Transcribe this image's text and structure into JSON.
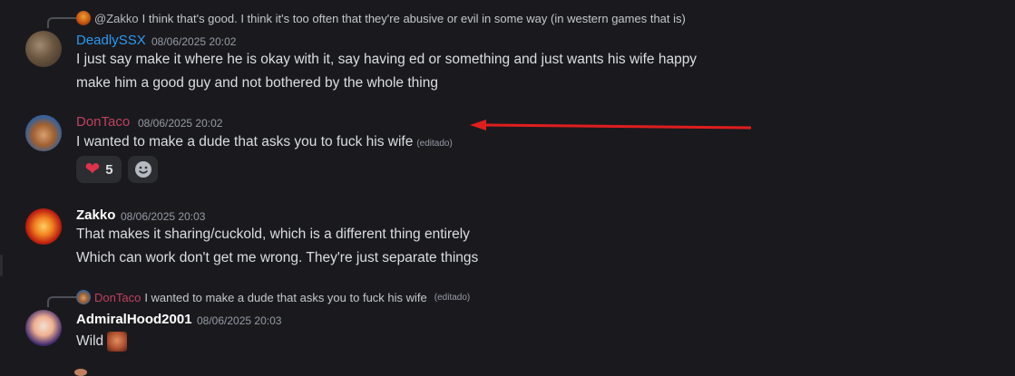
{
  "messages": [
    {
      "reply": {
        "name": "@Zakko",
        "text": "I think that's good. I think it's too often that they're abusive or evil in some way (in western games that is)"
      },
      "username": "DeadlySSX",
      "username_color": "#2b9af3",
      "timestamp": "08/06/2025 20:02",
      "lines": [
        "I just say make it where he is okay with it, say having ed or something and just wants his wife happy",
        "make him a good guy and not bothered by the whole thing"
      ]
    },
    {
      "username": "DonTaco",
      "username_color": "#c0405f",
      "timestamp": "08/06/2025 20:02",
      "lines": [
        "I wanted to make a dude that asks you to fuck his wife"
      ],
      "edited": "(editado)",
      "reactions": [
        {
          "icon": "heart-icon",
          "count": "5"
        },
        {
          "icon": "add-reaction-icon"
        }
      ]
    },
    {
      "username": "Zakko",
      "username_color": "#ffffff",
      "timestamp": "08/06/2025 20:03",
      "lines": [
        "That makes it sharing/cuckold, which is a different thing entirely",
        "Which can work don't get me wrong. They're just separate things"
      ]
    },
    {
      "reply": {
        "name": "DonTaco",
        "name_color": "#c0405f",
        "text": "I wanted to make a dude that asks you to fuck his wife",
        "edited": "(editado)"
      },
      "username": "AdmiralHood2001",
      "username_color": "#ffffff",
      "timestamp": "08/06/2025 20:03",
      "lines": [
        "Wild"
      ]
    }
  ],
  "annotation_arrow_color": "#e01e1e"
}
